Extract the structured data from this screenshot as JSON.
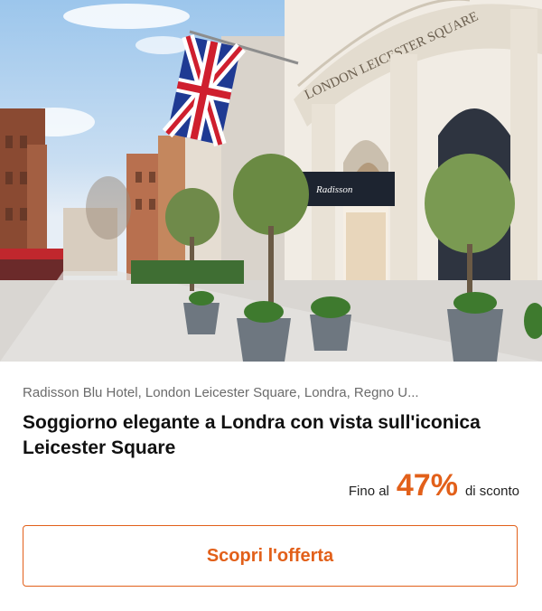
{
  "offer": {
    "location": "Radisson Blu Hotel, London Leicester Square, Londra, Regno U...",
    "title": "Soggiorno elegante a Londra con vista sull'iconica Leicester Square",
    "discount": {
      "prefix": "Fino al",
      "value": "47%",
      "suffix": "di sconto"
    },
    "cta_label": "Scopri l'offerta"
  },
  "hero": {
    "facade_sign": "LONDON LEICESTER SQUARE",
    "canopy_sign": "Radisson"
  },
  "colors": {
    "accent": "#e2601a",
    "muted_text": "#6b6b6b"
  }
}
